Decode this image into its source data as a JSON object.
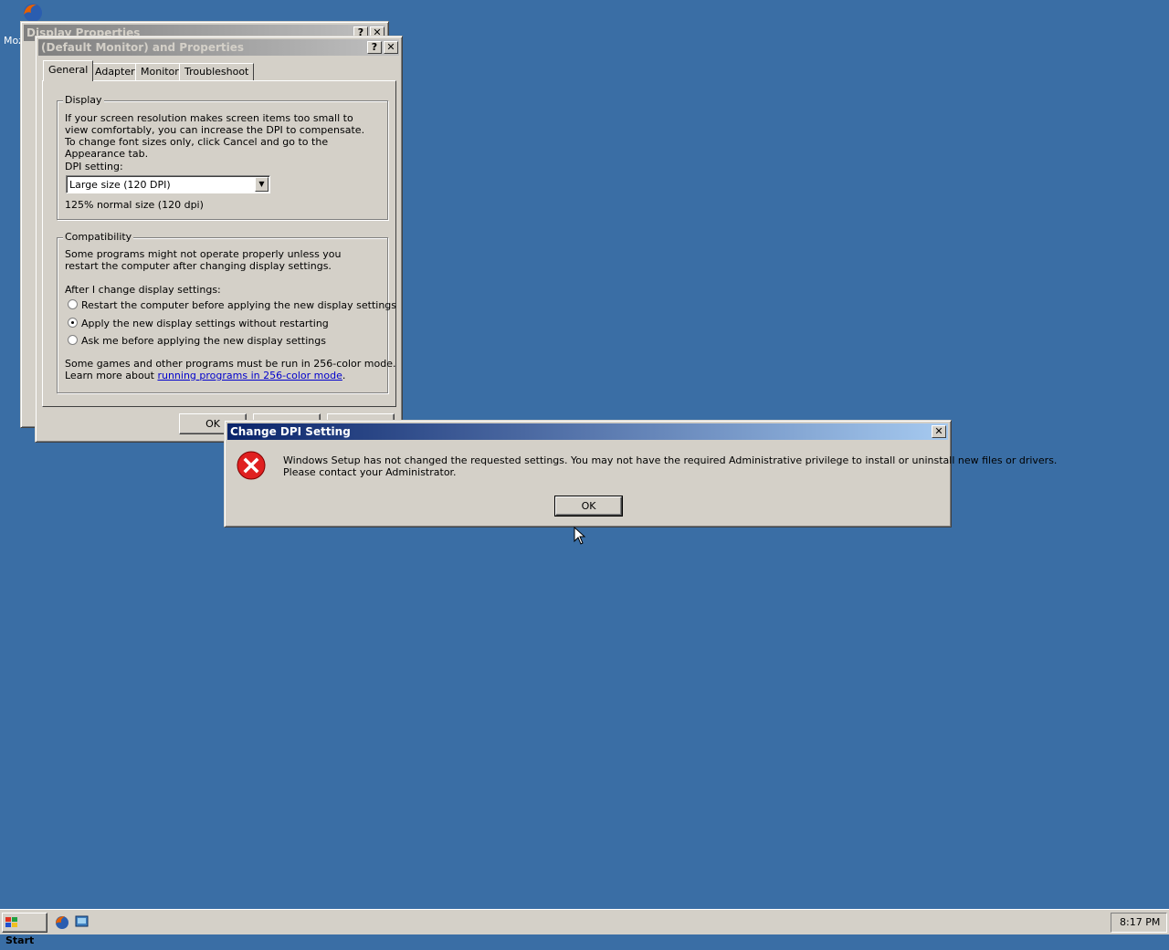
{
  "desktop": {
    "icon_label": "Moz",
    "background_color": "#3a6ea5"
  },
  "display_properties": {
    "title": "Display Properties",
    "help_icon": "?",
    "close_icon": "✕"
  },
  "monitor_properties": {
    "title": "(Default Monitor) and  Properties",
    "help_icon": "?",
    "close_icon": "✕",
    "tabs": [
      {
        "label": "General"
      },
      {
        "label": "Adapter"
      },
      {
        "label": "Monitor"
      },
      {
        "label": "Troubleshoot"
      }
    ],
    "display_group": {
      "legend": "Display",
      "description": "If your screen resolution makes screen items too small to view comfortably, you can increase the DPI to compensate.  To change font sizes only, click Cancel and go to the Appearance tab.",
      "dpi_label": "DPI setting:",
      "dpi_value": "Large size (120 DPI)",
      "dpi_note": "125% normal size (120 dpi)"
    },
    "compat_group": {
      "legend": "Compatibility",
      "description": "Some programs might not operate properly unless you restart the computer after changing display settings.",
      "after_label": "After I change display settings:",
      "options": [
        {
          "label": "Restart the computer before applying the new display settings",
          "selected": false
        },
        {
          "label": "Apply the new display settings without restarting",
          "selected": true
        },
        {
          "label": "Ask me before applying the new display settings",
          "selected": false
        }
      ],
      "games_text": "Some games and other programs must be run in 256-color mode.",
      "learn_prefix": "Learn more about ",
      "learn_link": "running programs in 256-color mode",
      "learn_suffix": "."
    },
    "ok_label": "OK"
  },
  "error_dialog": {
    "title": "Change DPI Setting",
    "close_icon": "✕",
    "icon": "error-icon",
    "message_line1": "Windows Setup has not changed the requested settings.  You may not have the required Administrative privilege to install or uninstall new files or drivers.",
    "message_line2": "Please contact your Administrator.",
    "ok_label": "OK"
  },
  "taskbar": {
    "start_label": "Start",
    "clock": "8:17 PM"
  }
}
